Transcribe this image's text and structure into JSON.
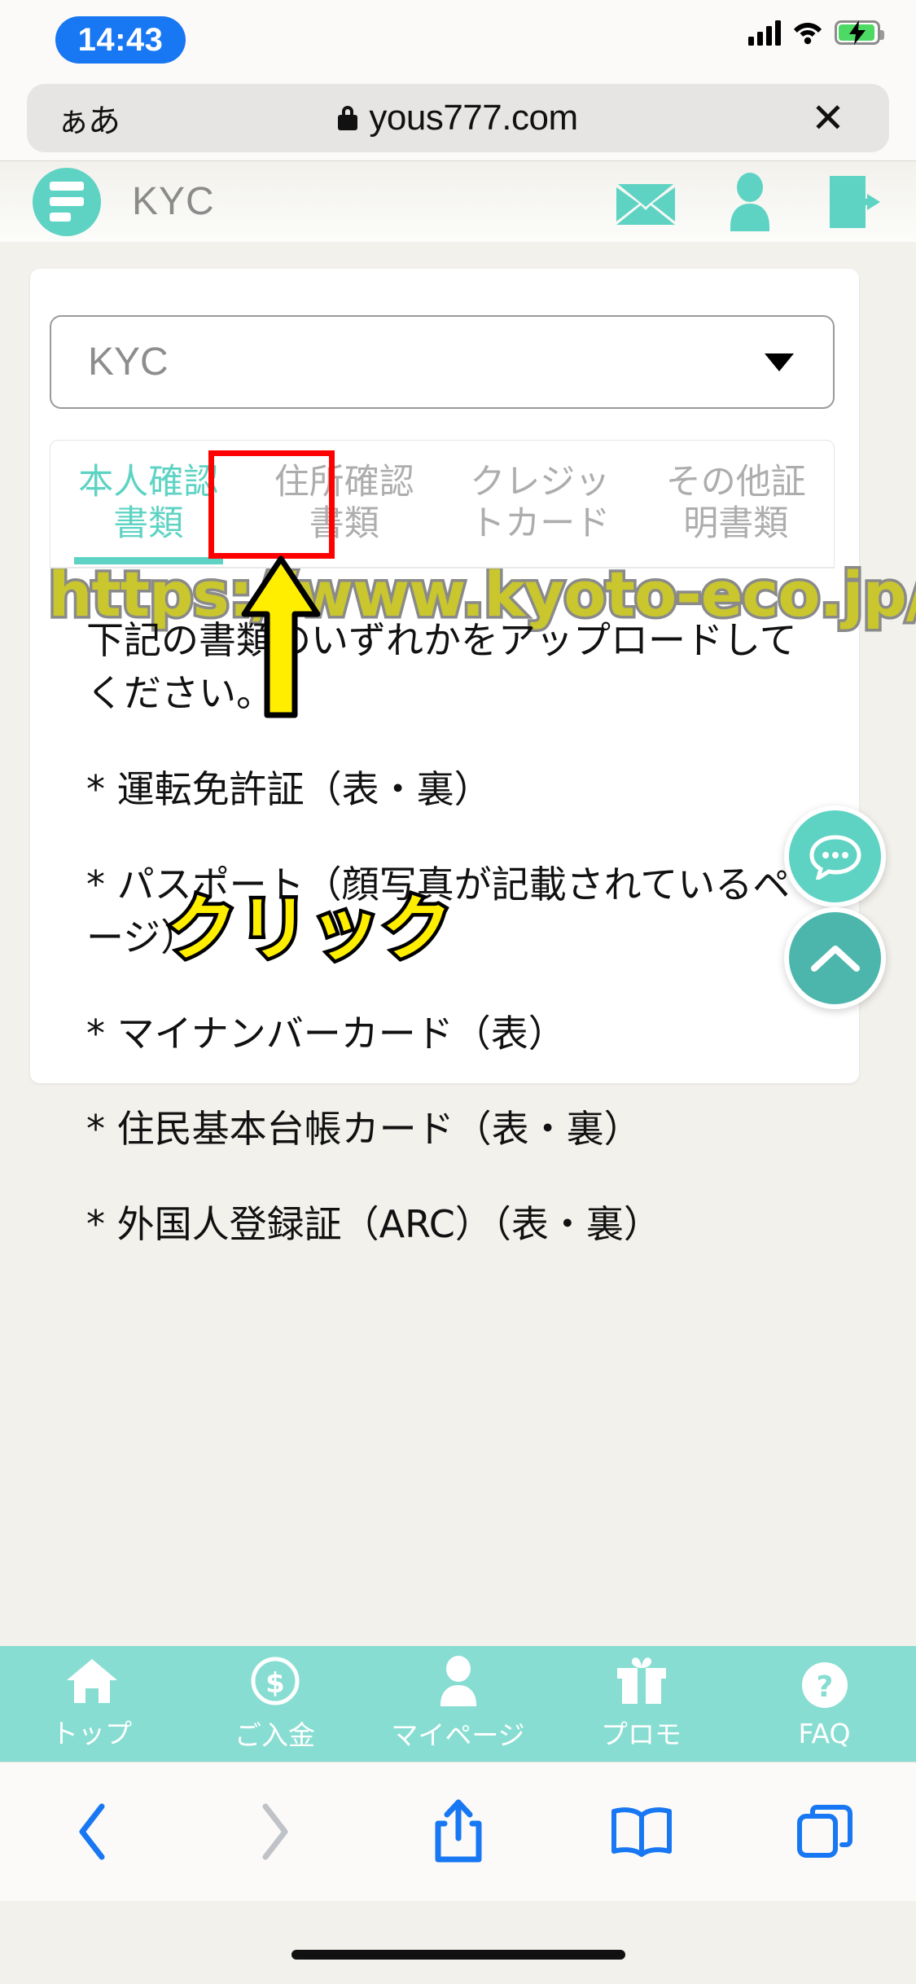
{
  "status_bar": {
    "time": "14:43",
    "time_pill_color": "#1877f2",
    "signal_icon": "cellular-signal-icon",
    "wifi_icon": "wifi-icon",
    "battery_icon": "battery-charging-icon",
    "battery_color": "#4cd964"
  },
  "browser": {
    "text_size_label": "ぁあ",
    "lock_icon": "lock-icon",
    "url": "yous777.com",
    "close_label": "✕",
    "toolbar": {
      "back_icon": "chevron-left-icon",
      "forward_icon": "chevron-right-icon",
      "share_icon": "share-icon",
      "bookmarks_icon": "book-icon",
      "tabs_icon": "tabs-icon"
    }
  },
  "site_header": {
    "menu_icon": "hamburger-menu-icon",
    "title": "KYC",
    "icons": [
      {
        "name": "mail-icon"
      },
      {
        "name": "user-account-icon"
      },
      {
        "name": "logout-icon"
      }
    ],
    "accent_color": "#5ed3c4"
  },
  "select": {
    "value": "KYC",
    "caret_icon": "chevron-down-icon"
  },
  "watermark": {
    "text": "https://www.kyoto-eco.jp/",
    "fill_color": "#c9c62e",
    "stroke_color": "#8a8a8a"
  },
  "tabs": [
    {
      "label": "本人確認\n書類",
      "line1": "本人確認",
      "line2": "書類",
      "active": true
    },
    {
      "label": "住所確認\n書類",
      "line1": "住所確認",
      "line2": "書類",
      "active": false
    },
    {
      "label": "クレジッ\nトカード",
      "line1": "クレジッ",
      "line2": "トカード",
      "active": false
    },
    {
      "label": "その他証\n明書類",
      "line1": "その他証",
      "line2": "明書類",
      "active": false
    }
  ],
  "annotation": {
    "highlight_color": "#ff0000",
    "arrow_icon": "up-arrow-annotation",
    "arrow_color": "#ffee00",
    "click_text": "クリック"
  },
  "content": {
    "intro": "下記の書類のいずれかをアップロードしてください。",
    "items": [
      "* 運転免許証（表・裏）",
      "* パスポート（顔写真が記載されているページ）",
      "* マイナンバーカード（表）",
      "* 住民基本台帳カード（表・裏）",
      "* 外国人登録証（ARC）（表・裏）"
    ]
  },
  "floating_buttons": [
    {
      "name": "chat-button",
      "icon": "chat-bubble-icon",
      "color": "#5ed3c4"
    },
    {
      "name": "scroll-top-button",
      "icon": "chevron-up-icon",
      "color": "#4db6ac"
    }
  ],
  "app_nav": {
    "background": "#88ddd2",
    "items": [
      {
        "icon": "home-icon",
        "label": "トップ"
      },
      {
        "icon": "deposit-icon",
        "label": "ご入金"
      },
      {
        "icon": "mypage-icon",
        "label": "マイページ"
      },
      {
        "icon": "promo-icon",
        "label": "プロモ"
      },
      {
        "icon": "faq-icon",
        "label": "FAQ"
      }
    ]
  }
}
